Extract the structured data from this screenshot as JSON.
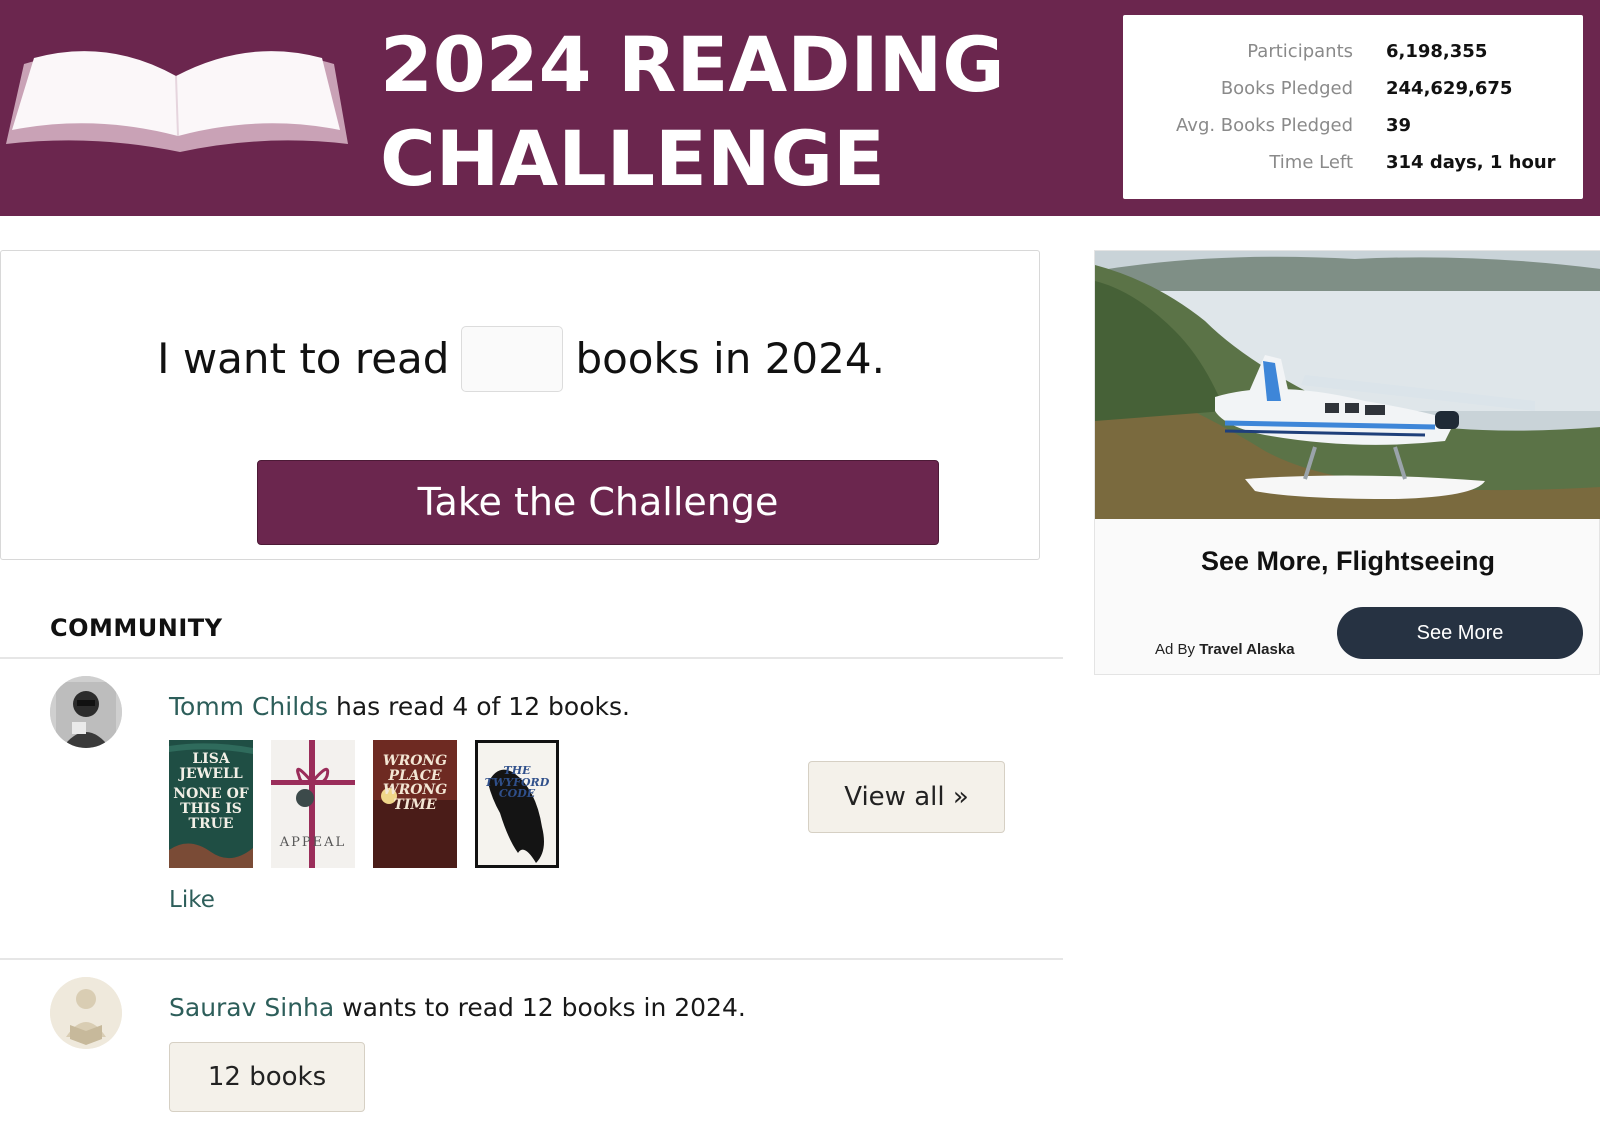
{
  "banner": {
    "title_line1": "2024 READING",
    "title_line2": "CHALLENGE",
    "colors": {
      "brand": "#6b264e",
      "book_page": "#fbf7f9",
      "book_edge": "#c9a2b6"
    },
    "logo_icon": "open-book-icon"
  },
  "stats": [
    {
      "label": "Participants",
      "value": "6,198,355"
    },
    {
      "label": "Books Pledged",
      "value": "244,629,675"
    },
    {
      "label": "Avg. Books Pledged",
      "value": "39"
    },
    {
      "label": "Time Left",
      "value": "314 days, 1 hour"
    }
  ],
  "pledge": {
    "prefix": "I want to read",
    "input_value": "",
    "suffix": "books in 2024.",
    "button_label": "Take the Challenge"
  },
  "community": {
    "title": "COMMUNITY",
    "items": [
      {
        "user": "Tomm Childs",
        "text": "has read 4 of 12 books.",
        "covers": [
          {
            "lines": [
              "LISA",
              "JEWELL",
              "NONE OF",
              "THIS IS",
              "TRUE"
            ],
            "color": "#1f4e44"
          },
          {
            "lines": [
              "APPEAL"
            ],
            "color": "#f3f1ee"
          },
          {
            "lines": [
              "WRONG",
              "PLACE",
              "WRONG",
              "TIME"
            ],
            "color": "#6e2a22"
          },
          {
            "lines": [
              "THE",
              "TWYFORD",
              "CODE"
            ],
            "color": "#f5f3ee"
          }
        ],
        "view_all_label": "View all »",
        "like_label": "Like"
      },
      {
        "user": "Saurav Sinha",
        "text": "wants to read 12 books in 2024.",
        "books_button_label": "12 books"
      }
    ],
    "colors": {
      "link": "#2d5e5a"
    }
  },
  "ad": {
    "headline": "See More, Flightseeing",
    "by_prefix": "Ad By",
    "advertiser": "Travel Alaska",
    "button_label": "See More",
    "image_icon": "seaplane-landscape-image",
    "colors": {
      "button": "#263242"
    }
  }
}
